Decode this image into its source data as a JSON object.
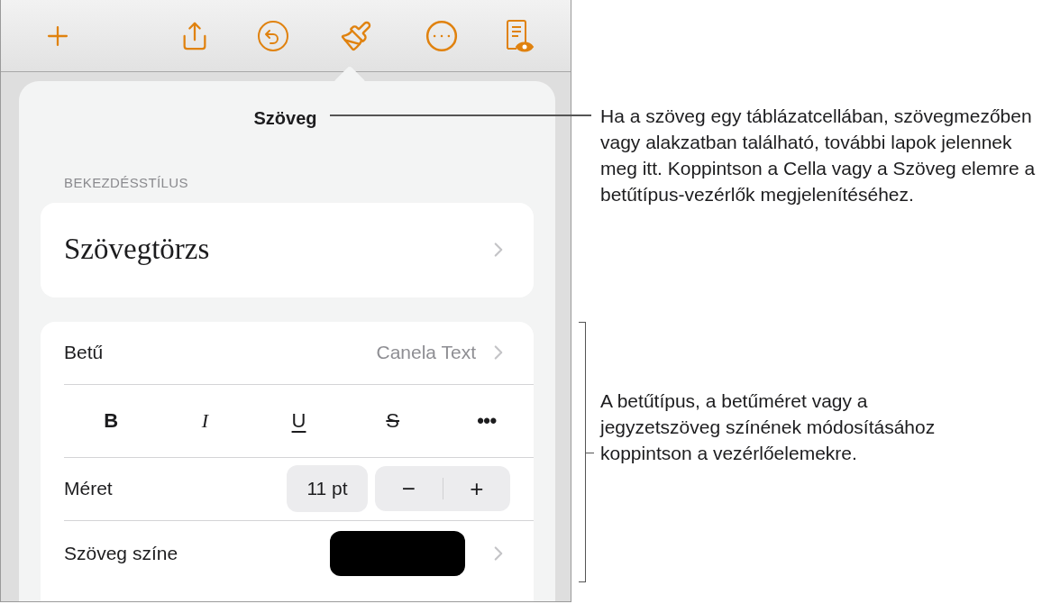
{
  "panel": {
    "title": "Szöveg",
    "paragraph_style_heading": "BEKEZDÉSSTÍLUS",
    "paragraph_style": "Szövegtörzs",
    "font": {
      "label": "Betű",
      "value": "Canela Text"
    },
    "format_buttons": [
      {
        "kind": "bold",
        "label": "B"
      },
      {
        "kind": "italic",
        "label": "I"
      },
      {
        "kind": "underline",
        "label": "U"
      },
      {
        "kind": "strike",
        "label": "S"
      },
      {
        "kind": "more",
        "label": "•••"
      }
    ],
    "size": {
      "label": "Méret",
      "value": "11 pt",
      "minus": "−",
      "plus": "+"
    },
    "text_color": {
      "label": "Szöveg színe",
      "color": "#000000"
    }
  },
  "callouts": [
    "Ha a szöveg egy táblázatcellában, szövegmezőben vagy alakzatban található, további lapok jelennek meg itt. Koppintson a Cella vagy a Szöveg elemre a betűtípus-vezérlők megjelenítéséhez.",
    "A betűtípus, a betűméret vagy a jegyzetszöveg színének módosításához koppintson a vezérlőelemekre."
  ]
}
